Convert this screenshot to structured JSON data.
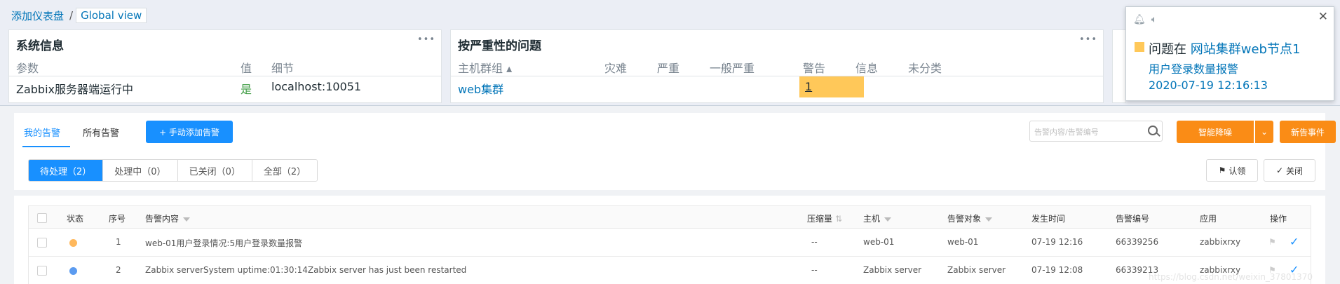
{
  "breadcrumb": {
    "item1": "添加仪表盘",
    "sep": "/",
    "item2": "Global view"
  },
  "system_info": {
    "title": "系统信息",
    "menu": "•••",
    "columns": [
      "参数",
      "值",
      "细节"
    ],
    "row": {
      "param": "Zabbix服务器端运行中",
      "value": "是",
      "detail": "localhost:10051"
    }
  },
  "problems_by_severity": {
    "title": "按严重性的问题",
    "menu": "•••",
    "columns": [
      "主机群组 ▴",
      "灾难",
      "严重",
      "一般严重",
      "警告",
      "信息",
      "未分类"
    ],
    "row": {
      "group": "web集群",
      "warning": "1"
    }
  },
  "notification": {
    "bell_icon": "bell-icon",
    "sound_icon": "speaker-icon",
    "close": "✕",
    "prefix": "问题在",
    "host": "网站集群web节点1",
    "problem": "用户登录数量报警",
    "time": "2020-07-19 12:16:13",
    "severity_color": "#ffc859"
  },
  "alarm": {
    "tabs": [
      "我的告警",
      "所有告警"
    ],
    "add_button": "+  手动添加告警",
    "search_placeholder": "告警内容/告警编号",
    "smart_button": "智能降噪",
    "new_event_button": "新告事件",
    "filters": [
      "待处理（2）",
      "处理中（0）",
      "已关闭（0）",
      "全部（2）"
    ],
    "ack_button": "认领",
    "close_button": "关闭",
    "columns": [
      "状态",
      "序号",
      "告警内容",
      "压缩量",
      "主机",
      "告警对象",
      "发生时间",
      "告警编号",
      "应用",
      "操作"
    ],
    "rows": [
      {
        "status_color": "#ffb85c",
        "index": "1",
        "content": "web-01用户登录情况:5用户登录数量报警",
        "compress": "--",
        "host": "web-01",
        "target": "web-01",
        "time": "07-19 12:16",
        "id": "66339256",
        "app": "zabbixrxy"
      },
      {
        "status_color": "#5b9bf0",
        "index": "2",
        "content": "Zabbix serverSystem uptime:01:30:14Zabbix server has just been restarted",
        "compress": "--",
        "host": "Zabbix server",
        "target": "Zabbix server",
        "time": "07-19 12:08",
        "id": "66339213",
        "app": "zabbixrxy"
      }
    ],
    "accent": "#1890ff",
    "orange": "#fa8c16"
  },
  "watermark": "https://blog.csdn.net/weixin_37801370"
}
